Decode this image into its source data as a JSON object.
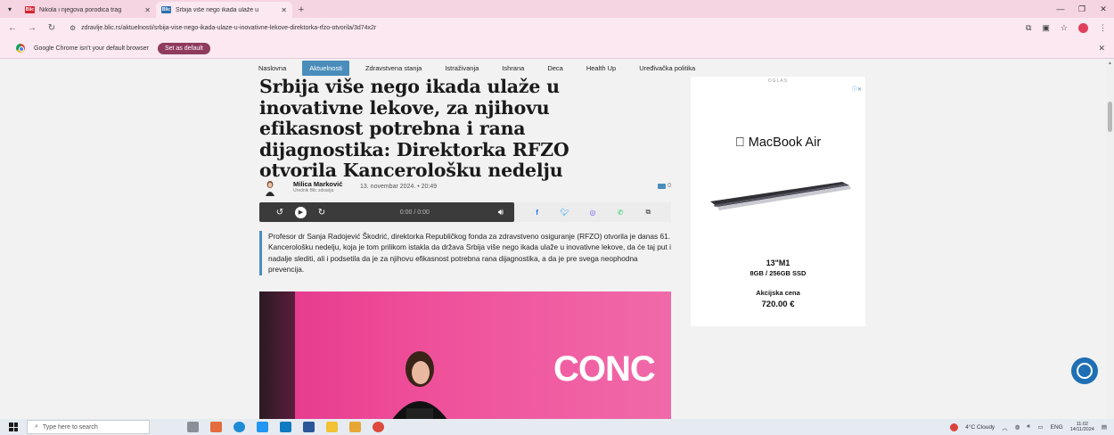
{
  "browser": {
    "tabs": [
      {
        "title": "Nikola i njegova porodica trag",
        "favicon": "Blic",
        "favicon_color": "#d4252f",
        "active": false
      },
      {
        "title": "Srbija više nego ikada ulaže u",
        "favicon": "Blic",
        "favicon_color": "#2c6fb0",
        "active": true
      }
    ],
    "url": "zdravlje.blic.rs/aktuelnosti/srbija-vise-nego-ikada-ulaze-u-inovativne-lekove-direktorka-rfzo-otvorila/3d74x2r",
    "infobar": {
      "message": "Google Chrome isn't your default browser",
      "button": "Set as default"
    }
  },
  "site_nav": {
    "items": [
      "Naslovna",
      "Aktuelnosti",
      "Zdravstvena stanja",
      "Istraživanja",
      "Ishrana",
      "Deca",
      "Health Up",
      "Uređivačka politika"
    ],
    "active": "Aktuelnosti"
  },
  "article": {
    "headline_lines": [
      "Srbija više nego ikada ulaže u",
      "inovativne lekove, za njihovu",
      "efikasnost potrebna i rana",
      "dijagnostika: Direktorka RFZO",
      "otvorila Kancerološku nedelju"
    ],
    "author": "Milica Marković",
    "author_role": "Urednik Blic zdravlja",
    "date": "13. novembar 2024.",
    "time": "20:49",
    "comments": "0",
    "player_time": "0:00 / 0:00",
    "lead": "Profesor dr Sanja Radojević Škodrić, direktorka Republičkog fonda za zdravstveno osiguranje (RFZO) otvorila je danas 61. Kancerološku nedelju, koja je tom prilikom istakla da država Srbija više nego ikada ulaže u inovativne lekove, da će taj put i nadalje slediti, ali i podsetila da je za njihovu efikasnost potrebna rana dijagnostika, a da je pre svega neophodna prevencija.",
    "photo_text": "CONC"
  },
  "ad": {
    "label": "OGLAS",
    "brand": "MacBook Air",
    "model": "13\"M1",
    "spec": "8GB / 256GB SSD",
    "promo": "Akcijska cena",
    "price": "720.00 €"
  },
  "taskbar": {
    "search_placeholder": "Type here to search",
    "weather": "4°C  Cloudy",
    "language": "ENG",
    "time": "11:02",
    "date": "14/11/2024"
  },
  "colors": {
    "accent": "#4a8dbb",
    "tabstrip": "#f6d5e3",
    "toolbar": "#fbe8f0",
    "set_default": "#8e3b5f",
    "photo_pink": "#e5378c"
  }
}
